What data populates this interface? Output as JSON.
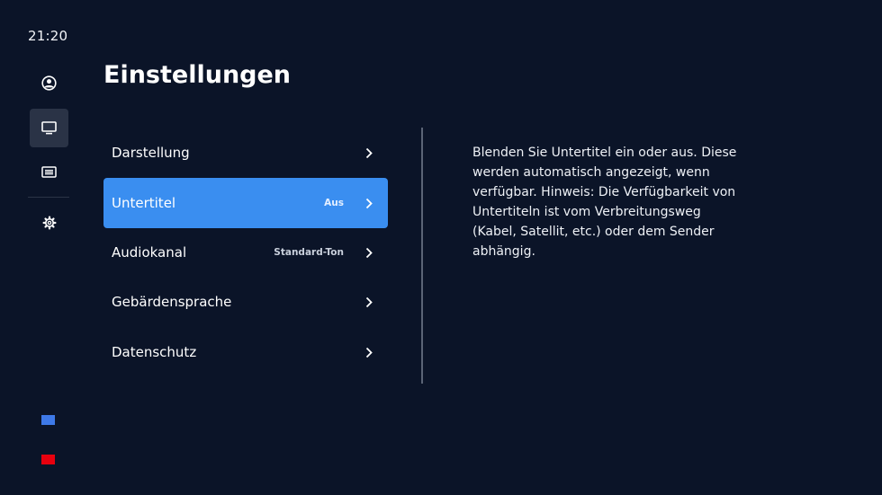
{
  "status": {
    "time": "21:20"
  },
  "sidebar": {
    "items": [
      {
        "icon": "account-icon",
        "active": false
      },
      {
        "icon": "tv-icon",
        "active": true
      },
      {
        "icon": "guide-list-icon",
        "active": false
      },
      {
        "icon": "gear-icon",
        "active": false
      }
    ],
    "color_keys": [
      {
        "name": "blue-key",
        "color": "#3e79e8"
      },
      {
        "name": "red-key",
        "color": "#e8000e"
      }
    ]
  },
  "page": {
    "title": "Einstellungen"
  },
  "menu": {
    "items": [
      {
        "label": "Darstellung",
        "value": ""
      },
      {
        "label": "Untertitel",
        "value": "Aus",
        "selected": true
      },
      {
        "label": "Audiokanal",
        "value": "Standard-Ton"
      },
      {
        "label": "Gebärdensprache",
        "value": ""
      },
      {
        "label": "Datenschutz",
        "value": ""
      }
    ]
  },
  "description": {
    "text": "Blenden Sie Untertitel ein oder aus. Diese werden automatisch angezeigt, wenn verfügbar. Hinweis: Die Verfügbarkeit von Untertiteln ist vom Verbreitungsweg (Kabel, Satellit, etc.) oder dem Sender abhängig."
  },
  "colors": {
    "background": "#0b1428",
    "accent": "#3a8ef0",
    "sidebar_active": "#2a3346"
  }
}
